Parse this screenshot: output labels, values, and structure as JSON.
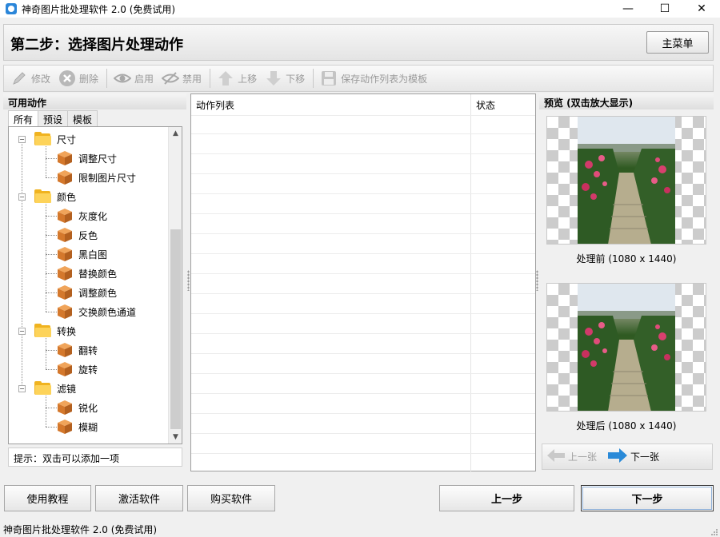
{
  "window": {
    "title": "神奇图片批处理软件 2.0 (免费试用)",
    "controls": {
      "minimize": "—",
      "maximize": "☐",
      "close": "✕"
    }
  },
  "header": {
    "step_title": "第二步：选择图片处理动作",
    "main_menu_label": "主菜单"
  },
  "toolbar": {
    "edit_label": "修改",
    "delete_label": "删除",
    "enable_label": "启用",
    "disable_label": "禁用",
    "move_up_label": "上移",
    "move_down_label": "下移",
    "save_template_label": "保存动作列表为模板"
  },
  "left_panel": {
    "title": "可用动作",
    "tabs": [
      "所有",
      "预设",
      "模板"
    ],
    "tree": [
      {
        "group": "尺寸",
        "items": [
          "调整尺寸",
          "限制图片尺寸"
        ]
      },
      {
        "group": "颜色",
        "items": [
          "灰度化",
          "反色",
          "黑白图",
          "替换颜色",
          "调整颜色",
          "交换颜色通道"
        ]
      },
      {
        "group": "转换",
        "items": [
          "翻转",
          "旋转"
        ]
      },
      {
        "group": "滤镜",
        "items": [
          "锐化",
          "模糊"
        ]
      }
    ],
    "hint": "提示：双击可以添加一项"
  },
  "action_list": {
    "columns": [
      "动作列表",
      "状态"
    ],
    "rows": []
  },
  "preview": {
    "title": "预览 (双击放大显示)",
    "before_caption": "处理前 (1080 x 1440)",
    "after_caption": "处理后 (1080 x 1440)",
    "prev_label": "上一张",
    "next_label": "下一张"
  },
  "bottom": {
    "tutorial_label": "使用教程",
    "activate_label": "激活软件",
    "buy_label": "购买软件",
    "prev_step_label": "上一步",
    "next_step_label": "下一步"
  },
  "statusbar": {
    "text": "神奇图片批处理软件 2.0 (免费试用)"
  },
  "colors": {
    "folder": "#f0b320",
    "box": "#d4782c",
    "arrow_active": "#2a8ad8",
    "disabled_text": "#9a9a9a"
  }
}
